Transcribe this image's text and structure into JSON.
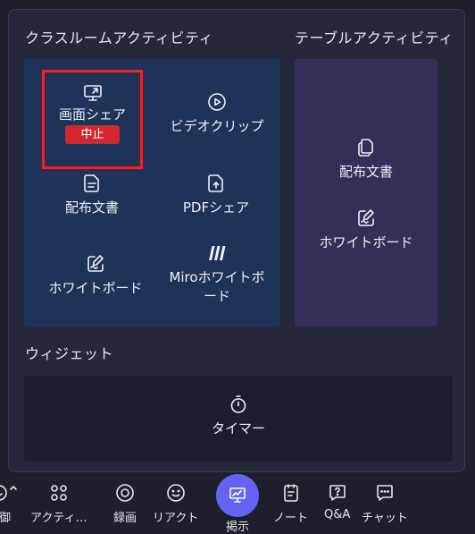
{
  "panel": {
    "classroom_title": "クラスルームアクティビティ",
    "table_title": "テーブルアクティビティ",
    "widgets_title": "ウィジェット"
  },
  "classroom": {
    "screen_share": {
      "label": "画面シェア",
      "stop_label": "中止",
      "icon": "screen-share-icon"
    },
    "video_clip": {
      "label": "ビデオクリップ",
      "icon": "play-circle-icon"
    },
    "document": {
      "label": "配布文書",
      "icon": "document-icon"
    },
    "pdf_share": {
      "label": "PDFシェア",
      "icon": "upload-document-icon"
    },
    "whiteboard": {
      "label": "ホワイトボード",
      "icon": "whiteboard-icon"
    },
    "miro": {
      "label": "Miroホワイトボード",
      "icon": "miro-logo-icon"
    }
  },
  "table": {
    "document": {
      "label": "配布文書",
      "icon": "document-icon"
    },
    "whiteboard": {
      "label": "ホワイトボード",
      "icon": "whiteboard-icon"
    }
  },
  "widgets": {
    "timer": {
      "label": "タイマー",
      "icon": "timer-icon"
    }
  },
  "toolbar": {
    "controls": "制御",
    "activities": "アクティ…",
    "record": "録画",
    "reactions": "リアクト",
    "present": "掲示",
    "notes": "ノート",
    "qa": "Q&A",
    "chat": "チャット"
  },
  "colors": {
    "classroom_bg": "#1e3358",
    "table_bg": "#352f58",
    "widgets_bg": "#1b1c31",
    "highlight_border": "#e8252c",
    "stop_button": "#d6262d",
    "present_accent": "#6463f2"
  }
}
